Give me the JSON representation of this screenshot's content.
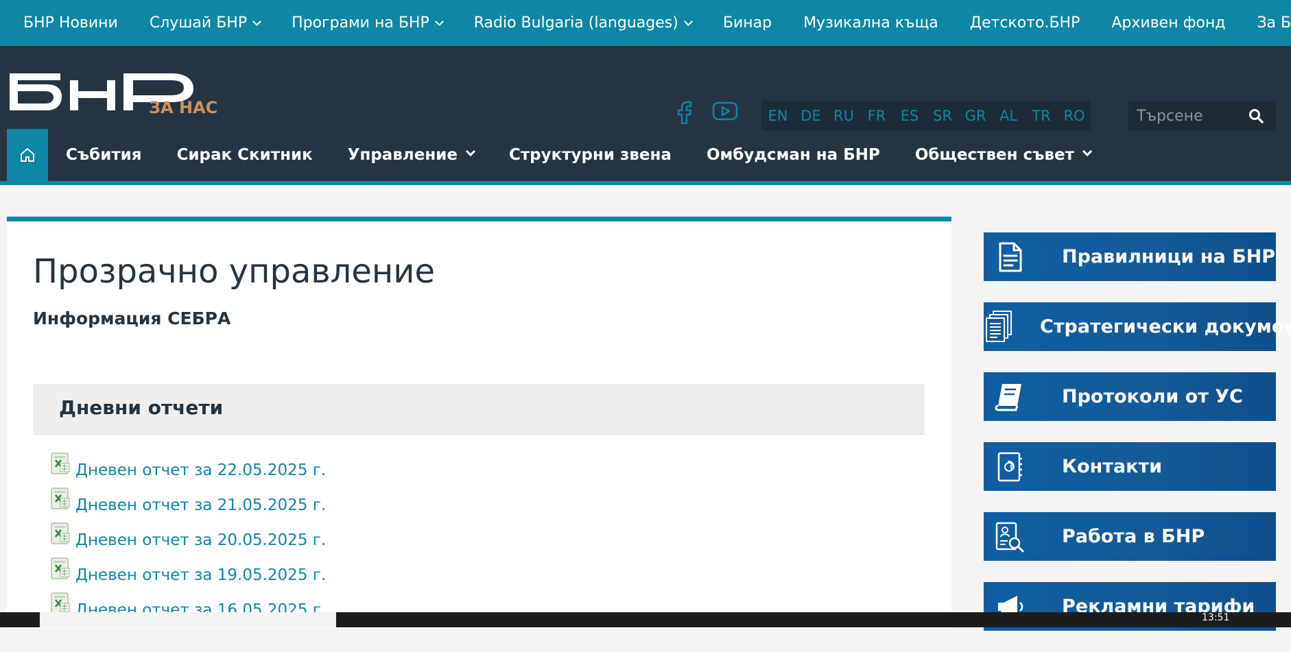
{
  "topbar": {
    "items": [
      {
        "label": "БНР Новини",
        "dropdown": false
      },
      {
        "label": "Слушай БНР",
        "dropdown": true
      },
      {
        "label": "Програми на БНР",
        "dropdown": true
      },
      {
        "label": "Radio Bulgaria (languages)",
        "dropdown": true
      },
      {
        "label": "Бинар",
        "dropdown": false
      },
      {
        "label": "Музикална къща",
        "dropdown": false
      },
      {
        "label": "Детското.БНР",
        "dropdown": false
      },
      {
        "label": "Архивен фонд",
        "dropdown": false
      },
      {
        "label": "За БНР",
        "dropdown": false
      }
    ]
  },
  "header": {
    "logo_text": "БНР",
    "logo_sub": "ЗА НАС",
    "social_icons": [
      "facebook-icon",
      "youtube-icon"
    ],
    "languages": [
      "EN",
      "DE",
      "RU",
      "FR",
      "ES",
      "SR",
      "GR",
      "AL",
      "TR",
      "RO"
    ],
    "search_placeholder": "Търсене"
  },
  "nav": {
    "home_icon": "home-icon",
    "items": [
      {
        "label": "Събития",
        "dropdown": false
      },
      {
        "label": "Сирак Скитник",
        "dropdown": false
      },
      {
        "label": "Управление",
        "dropdown": true
      },
      {
        "label": "Структурни звена",
        "dropdown": false
      },
      {
        "label": "Омбудсман на БНР",
        "dropdown": false
      },
      {
        "label": "Обществен съвет",
        "dropdown": true
      }
    ]
  },
  "main": {
    "title": "Прозрачно управление",
    "subtitle": "Информация СЕБРА",
    "section_title": "Дневни отчети",
    "reports": [
      "Дневен отчет за 22.05.2025 г.",
      "Дневен отчет за 21.05.2025 г.",
      "Дневен отчет за 20.05.2025 г.",
      "Дневен отчет за 19.05.2025 г.",
      "Дневен отчет за 16.05.2025 г."
    ]
  },
  "sidebar": {
    "buttons": [
      {
        "label": "Правилници на БНР",
        "icon": "document-icon"
      },
      {
        "label": "Стратегически документи",
        "icon": "documents-stack-icon"
      },
      {
        "label": "Протоколи от УС",
        "icon": "book-icon"
      },
      {
        "label": "Контакти",
        "icon": "address-book-icon"
      },
      {
        "label": "Работа в БНР",
        "icon": "job-search-icon"
      },
      {
        "label": "Рекламни тарифи",
        "icon": "megaphone-icon"
      }
    ]
  },
  "taskbar": {
    "clock": "13:51"
  },
  "colors": {
    "accent": "#0f86a6",
    "header_bg": "#253441",
    "sidebar_button": "#145a96",
    "logo_sub": "#c9935f"
  }
}
